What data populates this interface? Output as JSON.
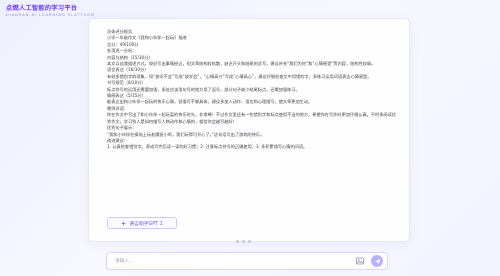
{
  "brand": {
    "title": "点燃人工智能的学习平台",
    "subtitle": "DIANRAN AI LEARNING PLATFORM"
  },
  "chat": {
    "lines": [
      "总体评分报告",
      "小学一年级作文《我和小伙伴一起玩》批改",
      "总分：49/100分",
      "各项逐一分析：",
      "内容与结构（15/30分）",
      "本文以自我描述方式，较好写出事情经过，但文章结构较松散，缺乏开头和结尾的总写，建议补充“我们为何”和“心情感受”等内容，结构性较弱。",
      "语言表达（16/30分）",
      "有较多错别字的现象，如“放学不会”写成“放学会”，“心情高兴”写成“心情高心”，建议仔细检查文中用错的字，多练习运用词语表达心情感受。",
      "书写规范（8/20分）",
      "标点符号的运用还需要加强，多处应该用句号的地方用了逗号，部分句子缺少结尾标点，还需加强练习。",
      "情感表达（5/15分）",
      "能表达出和小伙伴一起玩的快乐心情，但描写不够具体，建议多加入动作、语言和心理描写，使文章更加生动。",
      "教师评语：",
      "你在作文中写出了和小伙伴一起玩耍的快乐时光，非常棒！不过作文里还有一些错别字和标点使用不当的地方，希望你在写作时更加仔细认真。平时多阅读优秀作文，学习别人是如何描写人物动作和心情的，相信你会越写越好！",
      "优秀句子展示：",
      "“我和小伙伴在操场上玩老鹰捉小鸡，我们玩得可开心了。”这句话写出了游戏的快乐。",
      "改进建议：",
      "1. 认真检查错别字，养成写完后读一读的好习惯；2. 注意标点符号的正确使用；3. 多积累描写心情的词语。"
    ],
    "regen_label": "语言助手GPT 1"
  },
  "input": {
    "placeholder": "请输入..."
  },
  "colors": {
    "accent": "#6c5cff",
    "send": "#b7b2ff"
  },
  "icons": {
    "regen": "sparkle-icon",
    "image": "image-icon",
    "send": "send-icon"
  }
}
